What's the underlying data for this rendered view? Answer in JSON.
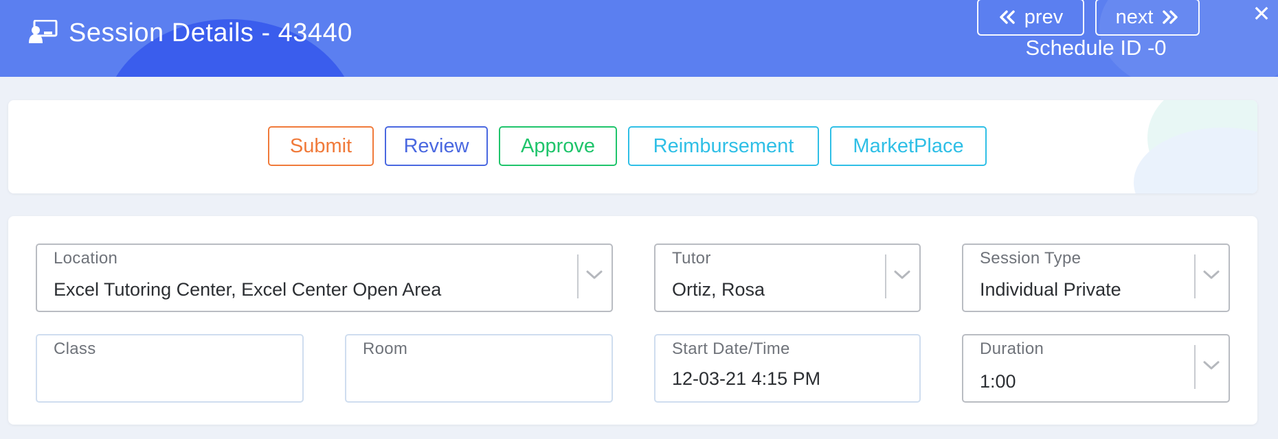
{
  "header": {
    "title": "Session Details - 43440",
    "title_icon": "tutoring-session-icon",
    "prev_label": "prev",
    "next_label": "next",
    "schedule_id": "Schedule ID -0",
    "close_label": "✕",
    "background_color": "#5b7ff0"
  },
  "actions": [
    {
      "label": "Submit",
      "color": "#f07a3a"
    },
    {
      "label": "Review",
      "color": "#4a68e0"
    },
    {
      "label": "Approve",
      "color": "#1fc46b"
    },
    {
      "label": "Reimbursement",
      "color": "#2fbfe6"
    },
    {
      "label": "MarketPlace",
      "color": "#2fbfe6"
    }
  ],
  "form": {
    "location": {
      "label": "Location",
      "value": "Excel Tutoring Center, Excel Center Open Area"
    },
    "tutor": {
      "label": "Tutor",
      "value": "Ortiz, Rosa"
    },
    "session_type": {
      "label": "Session Type",
      "value": "Individual Private"
    },
    "class": {
      "label": "Class",
      "value": ""
    },
    "room": {
      "label": "Room",
      "value": ""
    },
    "start": {
      "label": "Start Date/Time",
      "value": "12-03-21 4:15 PM"
    },
    "duration": {
      "label": "Duration",
      "value": "1:00"
    }
  }
}
